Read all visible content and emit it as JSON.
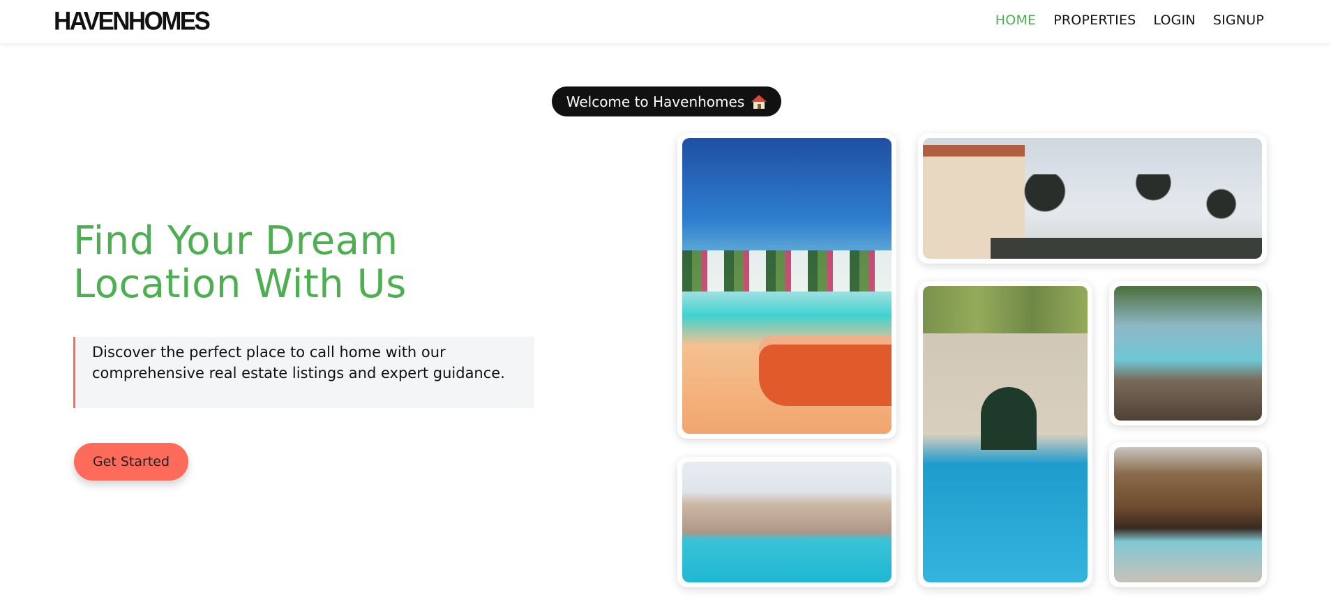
{
  "navbar": {
    "logo": "HAVENHOMES",
    "links": [
      {
        "label": "HOME",
        "active": true
      },
      {
        "label": "PROPERTIES",
        "active": false
      },
      {
        "label": "LOGIN",
        "active": false
      },
      {
        "label": "SIGNUP",
        "active": false
      }
    ]
  },
  "badge": {
    "text": "Welcome to Havenhomes",
    "icon": "house-icon"
  },
  "hero": {
    "title_line1": "Find Your Dream",
    "title_line2": "Location With Us",
    "description": "Discover the perfect place to call home with our comprehensive real estate listings and expert guidance.",
    "cta_label": "Get Started"
  },
  "colors": {
    "accent_green": "#4caf50",
    "cta_coral": "#ff6b5b",
    "badge_bg": "#111111",
    "desc_bg": "#f4f5f7"
  }
}
